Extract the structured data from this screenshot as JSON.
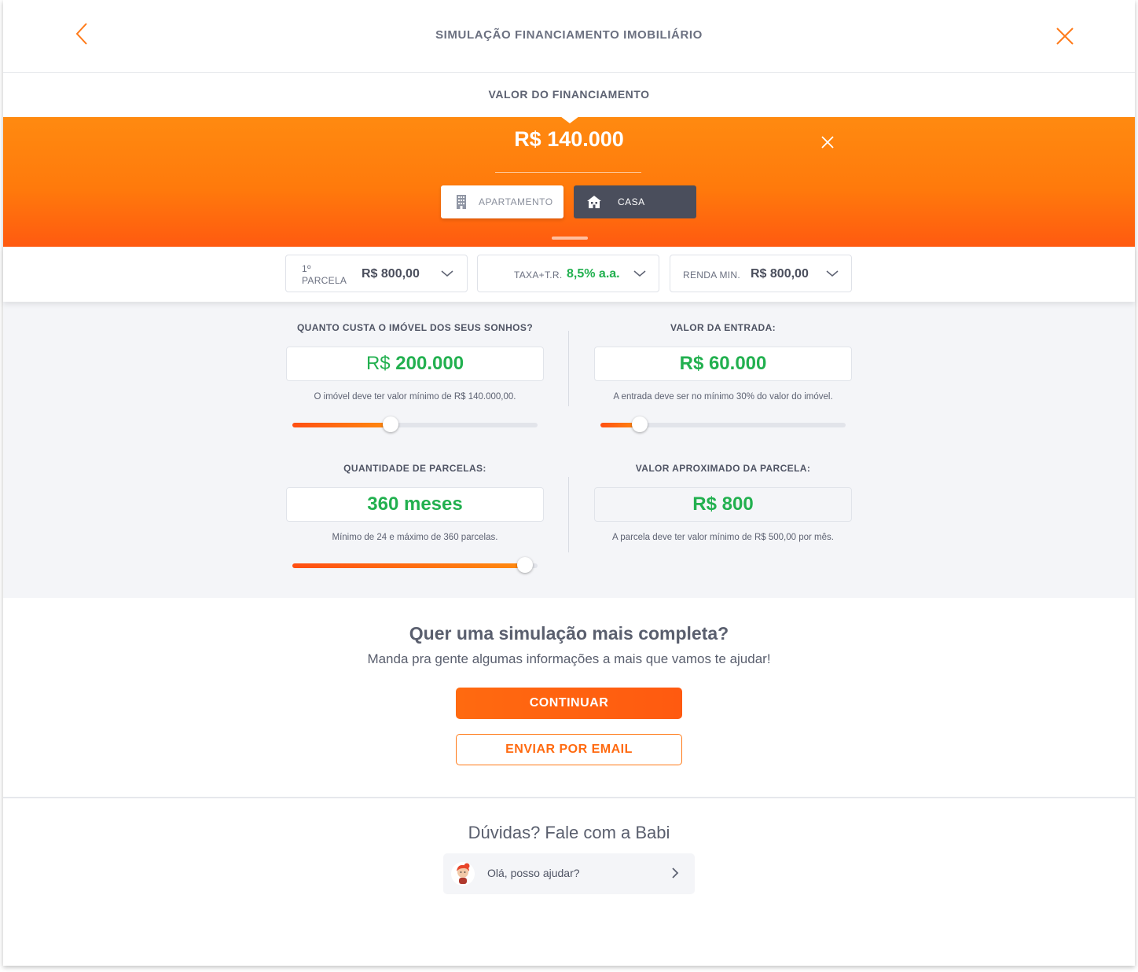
{
  "header": {
    "title": "SIMULAÇÃO FINANCIAMENTO IMOBILIÁRIO",
    "back_icon": "chevron-left-icon",
    "close_icon": "close-icon"
  },
  "financing": {
    "label": "VALOR DO FINANCIAMENTO",
    "amount": "R$ 140.000",
    "types": [
      {
        "label": "APARTAMENTO",
        "icon": "building-icon",
        "selected": false
      },
      {
        "label": "CASA",
        "icon": "house-icon",
        "selected": true
      }
    ]
  },
  "summary": {
    "first_installment": {
      "label_line1": "1º",
      "label_line2": "PARCELA",
      "value": "R$ 800,00"
    },
    "rate": {
      "label": "TAXA+T.R.",
      "value": "8,5% a.a."
    },
    "min_income": {
      "label": "RENDA MIN.",
      "value": "R$ 800,00"
    }
  },
  "fields": {
    "property_value": {
      "label": "QUANTO CUSTA O IMÓVEL DOS SEUS SONHOS?",
      "currency": "R$",
      "value": "200.000",
      "hint": "O imóvel deve ter valor mínimo de R$ 140.000,00.",
      "slider_level": 0.4
    },
    "down_payment": {
      "label": "VALOR DA ENTRADA:",
      "value": "R$ 60.000",
      "hint": "A entrada deve ser no mínimo 30% do valor do imóvel.",
      "slider_level": 0.16
    },
    "installments": {
      "label": "QUANTIDADE DE PARCELAS:",
      "value": "360 meses",
      "hint": "Mínimo de 24 e máximo de 360 parcelas.",
      "slider_level": 0.95
    },
    "installment_value": {
      "label": "VALOR APROXIMADO DA PARCELA:",
      "value": "R$ 800",
      "hint": "A parcela deve ter valor mínimo de R$ 500,00 por mês."
    }
  },
  "cta": {
    "title": "Quer uma simulação mais completa?",
    "subtitle": "Manda pra gente algumas informações a mais que vamos te ajudar!",
    "continue_label": "CONTINUAR",
    "email_label": "ENVIAR POR EMAIL"
  },
  "help": {
    "title": "Dúvidas? Fale com a Babi",
    "chat_text": "Olá, posso ajudar?"
  },
  "colors": {
    "brand_orange": "#ff7a0c",
    "value_green": "#22b04f",
    "dark_button": "#4a4e5c"
  }
}
